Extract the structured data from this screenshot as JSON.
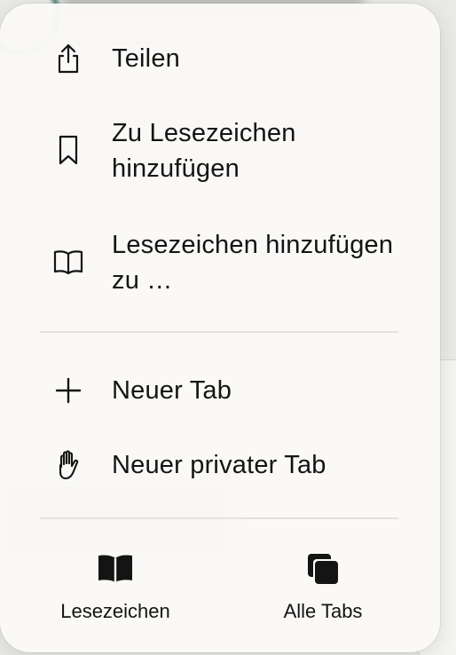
{
  "menu": {
    "items": [
      {
        "label": "Teilen",
        "icon": "share-icon"
      },
      {
        "label": "Zu Lesezeichen hinzufügen",
        "icon": "bookmark-icon"
      },
      {
        "label": "Lesezeichen hinzufügen zu …",
        "icon": "open-book-icon"
      },
      {
        "label": "Neuer Tab",
        "icon": "plus-icon"
      },
      {
        "label": "Neuer privater Tab",
        "icon": "hand-icon"
      }
    ],
    "bottom": [
      {
        "label": "Lesezeichen",
        "icon": "bookmarks-book-icon"
      },
      {
        "label": "Alle Tabs",
        "icon": "tabs-stack-icon"
      }
    ]
  }
}
